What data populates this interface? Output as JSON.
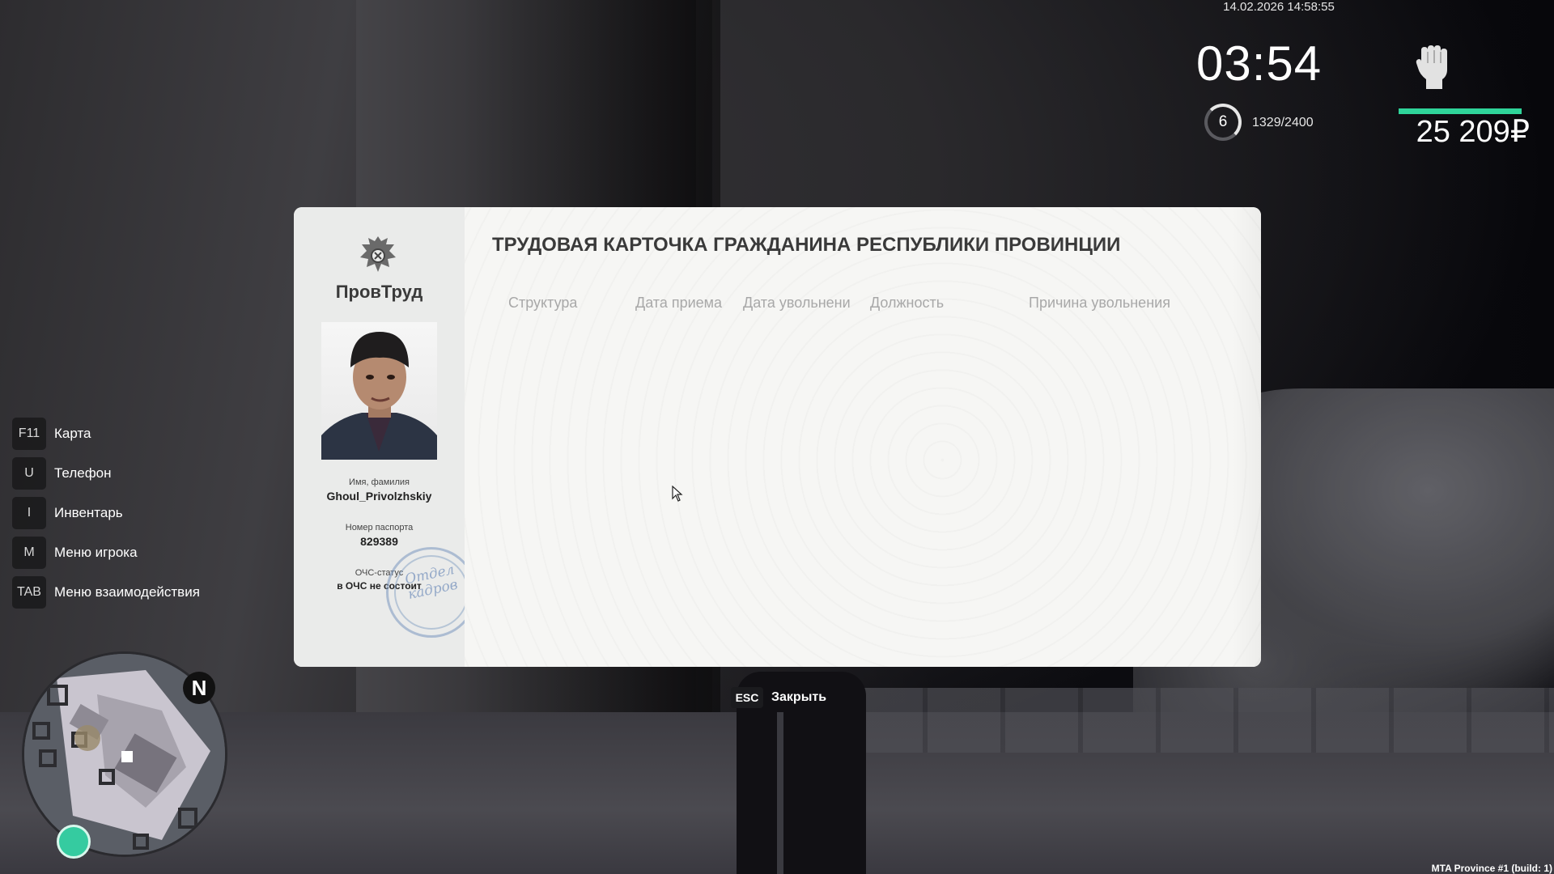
{
  "hud": {
    "datetime": "14.02.2026 14:58:55",
    "clock": "03:54",
    "level": "6",
    "xp": "1329/2400",
    "money": "25 209₽",
    "health_fraction": 1.0,
    "health_color": "#2fd49a"
  },
  "hotkeys": [
    {
      "key": "F11",
      "label": "Карта"
    },
    {
      "key": "U",
      "label": "Телефон"
    },
    {
      "key": "I",
      "label": "Инвентарь"
    },
    {
      "key": "M",
      "label": "Меню игрока"
    },
    {
      "key": "TAB",
      "label": "Меню взаимодействия"
    }
  ],
  "minimap": {
    "north": "N"
  },
  "card": {
    "org_name": "ПровТруд",
    "title": "ТРУДОВАЯ КАРТОЧКА ГРАЖДАНИНА РЕСПУБЛИКИ ПРОВИНЦИИ",
    "name_label": "Имя, фамилия",
    "name_value": "Ghoul_Privolzhskiy",
    "passport_label": "Номер паспорта",
    "passport_value": "829389",
    "status_label": "ОЧС-статус",
    "status_value": "в ОЧС не состоит",
    "stamp_text": "Отдел кадров",
    "columns": [
      "Структура",
      "Дата приема",
      "Дата увольнени",
      "Должность",
      "Причина увольнения"
    ],
    "rows": []
  },
  "close_hint": {
    "key": "ESC",
    "label": "Закрыть"
  },
  "build": "MTA Province #1 (build: 1)"
}
